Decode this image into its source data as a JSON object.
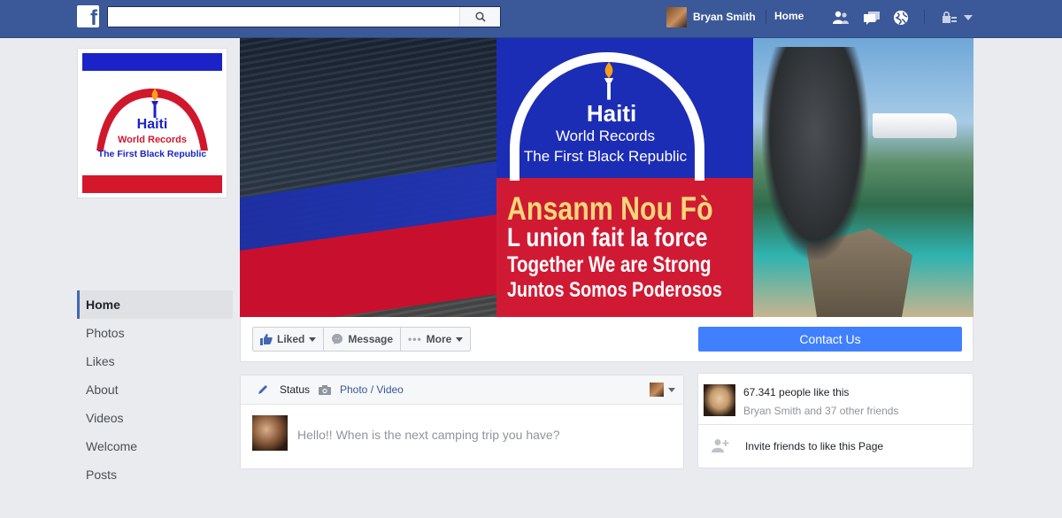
{
  "topbar": {
    "logo": "f",
    "search_placeholder": "",
    "user_name": "Bryan Smith",
    "home_label": "Home",
    "icons": [
      "friends-icon",
      "messages-icon",
      "notifications-globe-icon",
      "privacy-lock-icon",
      "account-menu-caret-icon"
    ],
    "bar_color": "#3b5998"
  },
  "profile_picture": {
    "logo_line1": "Haiti",
    "logo_line2": "World Records",
    "logo_line3": "The First Black Republic"
  },
  "sidebar": {
    "items": [
      {
        "label": "Home",
        "active": true
      },
      {
        "label": "Photos"
      },
      {
        "label": "Likes"
      },
      {
        "label": "About"
      },
      {
        "label": "Videos"
      },
      {
        "label": "Welcome"
      },
      {
        "label": "Posts"
      }
    ]
  },
  "cover": {
    "logo_line1": "Haiti",
    "logo_line2": "World Records",
    "logo_line3": "The First Black Republic",
    "slogans": [
      "Ansanm Nou Fò",
      "L union fait la force",
      "Together We are Strong",
      "Juntos Somos Poderosos"
    ],
    "slogan_accent_color": "#f6d77a"
  },
  "actions": {
    "liked_label": "Liked",
    "message_label": "Message",
    "more_label": "More",
    "contact_label": "Contact Us",
    "contact_color": "#4080ff"
  },
  "composer": {
    "status_label": "Status",
    "photo_video_label": "Photo / Video",
    "post_text": "Hello!! When is the next camping trip you have?"
  },
  "likes": {
    "count_text": "67.341 people like this",
    "friends_text": "Bryan Smith and 37 other friends",
    "invite_text": "Invite friends to like this Page"
  }
}
